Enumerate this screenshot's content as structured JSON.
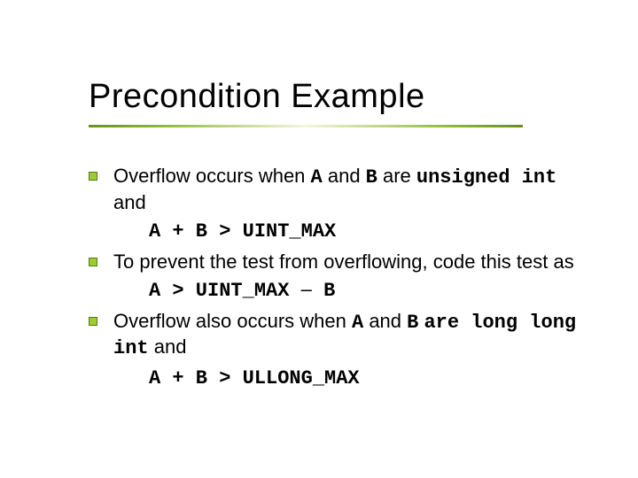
{
  "title": "Precondition Example",
  "p1": {
    "pre": "Overflow occurs when ",
    "code1": "A",
    "mid1": " and ",
    "code2": "B",
    "mid2": " are ",
    "code3": "unsigned int",
    "post": " and"
  },
  "expr1": "A + B > UINT_MAX",
  "p2": "To prevent the test from overflowing, code this test as",
  "expr2a": "A > UINT_MAX ",
  "expr2b": "–",
  "expr2c": " B",
  "p3": {
    "pre": "Overflow also occurs when ",
    "code1": "A",
    "mid1": " and ",
    "code2": "B",
    "mid2": " ",
    "code3": "are long long int",
    "post": " and"
  },
  "expr3": "A + B > ULLONG_MAX"
}
